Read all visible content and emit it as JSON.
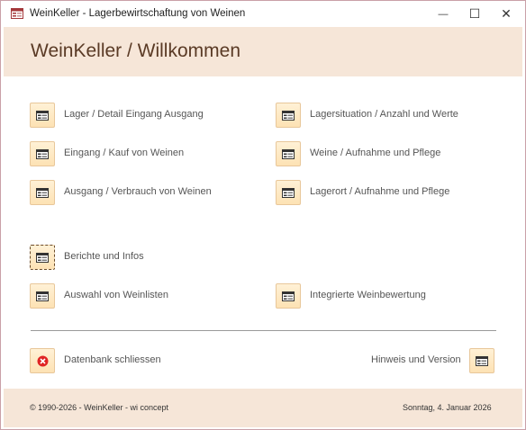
{
  "window": {
    "title": "WeinKeller - Lagerbewirtschaftung von Weinen",
    "controls": {
      "minimize": "—",
      "maximize": "☐",
      "close": "✕"
    }
  },
  "header": {
    "title": "WeinKeller / Willkommen"
  },
  "buttons": {
    "lager_detail": "Lager / Detail Eingang Ausgang",
    "eingang": "Eingang / Kauf von Weinen",
    "ausgang": "Ausgang / Verbrauch von Weinen",
    "lagersituation": "Lagersituation / Anzahl und Werte",
    "weine": "Weine / Aufnahme und Pflege",
    "lagerort": "Lagerort / Aufnahme und Pflege",
    "berichte": "Berichte und Infos",
    "weinlisten": "Auswahl von Weinlisten",
    "weinbewertung": "Integrierte Weinbewertung",
    "schliessen": "Datenbank schliessen",
    "hinweis": "Hinweis und Version"
  },
  "footer": {
    "copyright": "© 1990-2026 - WeinKeller - wi concept",
    "date": "Sonntag, 4. Januar 2026"
  },
  "colors": {
    "header_bg": "#f6e6d8",
    "button_bg": "#fde2b4",
    "close_icon": "#e02424",
    "title_text": "#5a3a25"
  }
}
